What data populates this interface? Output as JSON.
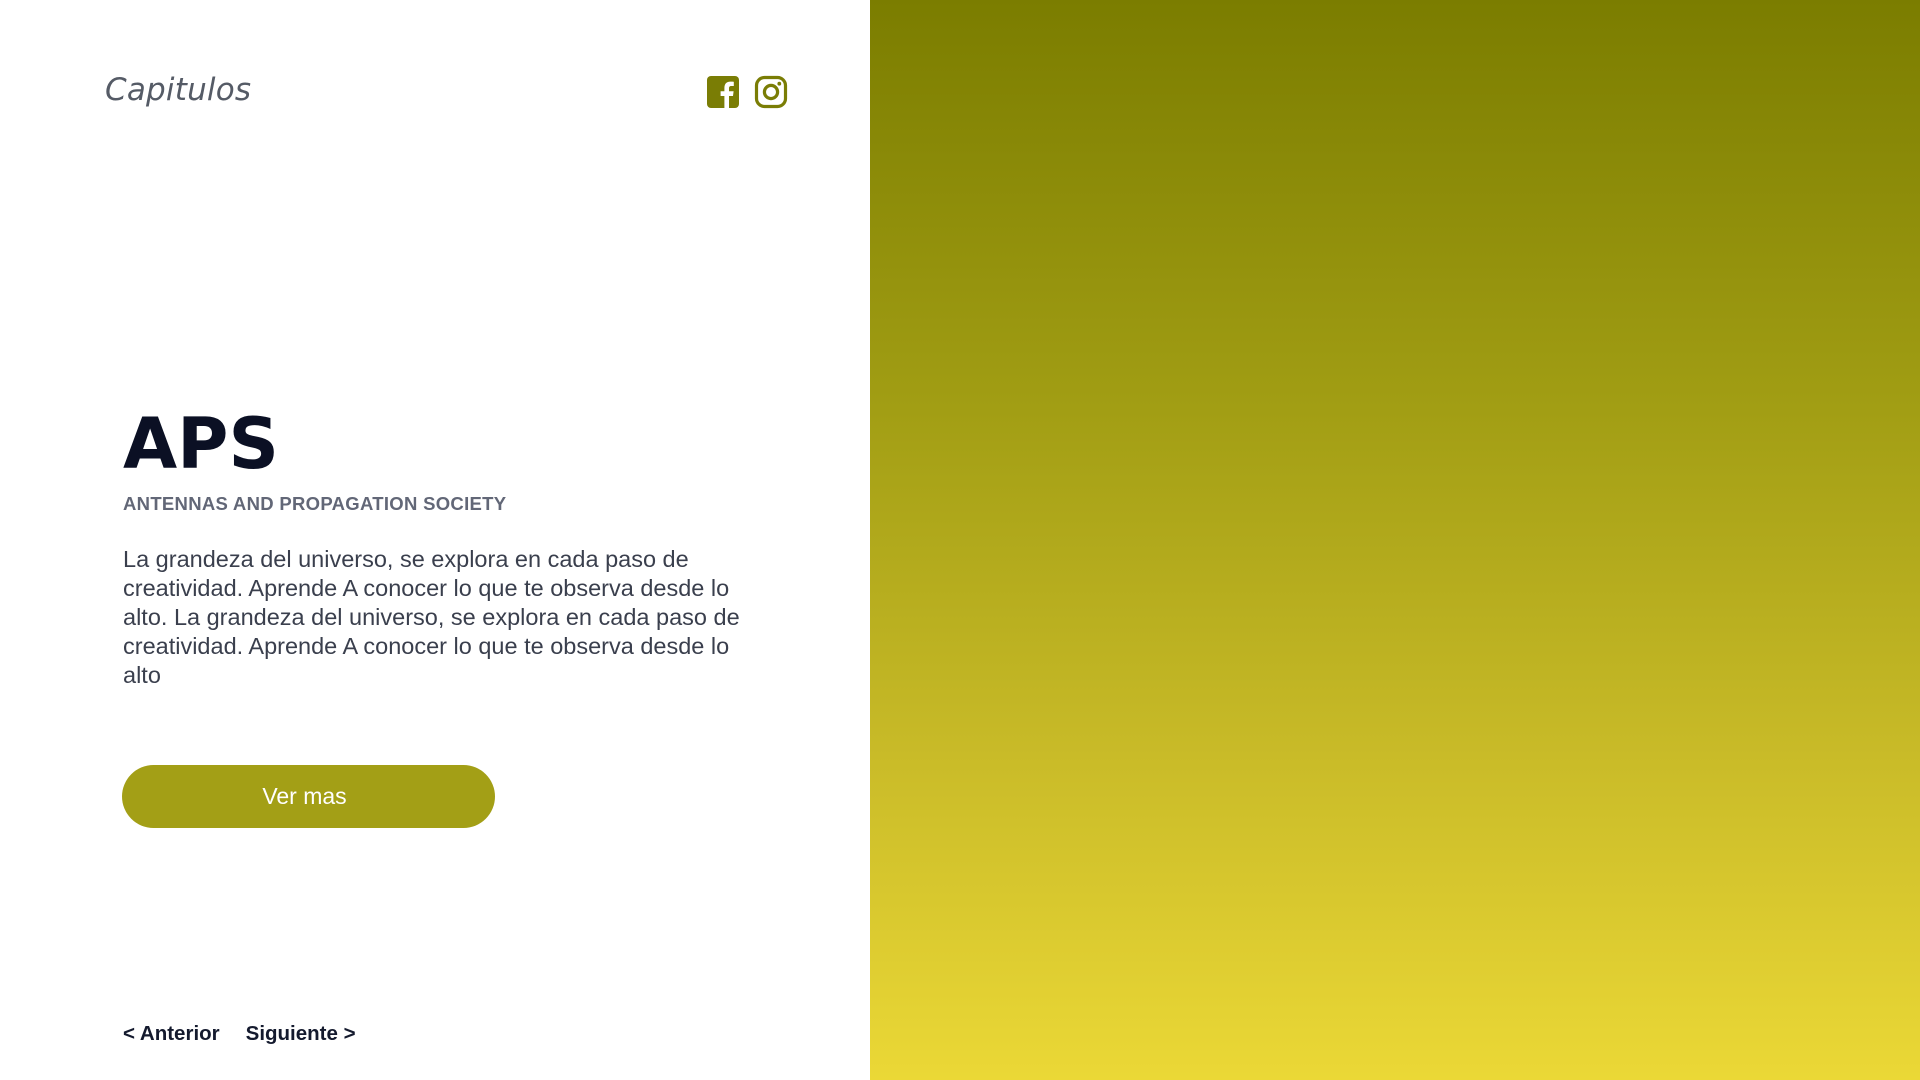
{
  "header": {
    "brand": "Capitulos",
    "social": [
      {
        "icon": "facebook-icon",
        "label": "Facebook"
      },
      {
        "icon": "instagram-icon",
        "label": "Instagram"
      }
    ]
  },
  "hero": {
    "title": "APS",
    "subtitle": "ANTENNAS AND PROPAGATION SOCIETY",
    "description": "La grandeza del universo, se explora en cada paso de creatividad. Aprende A conocer lo que te observa desde lo alto. La grandeza del universo, se explora en cada paso de creatividad. Aprende A conocer lo que te observa desde lo alto",
    "cta_label": "Ver mas"
  },
  "pagination": {
    "prev_label": "< Anterior",
    "next_label": "Siguiente >"
  },
  "colors": {
    "accent": "#a39f16",
    "icon": "#7a7d05",
    "gradient_top": "#7b7d00",
    "gradient_bottom": "#ebd836",
    "title": "#0b1024"
  }
}
